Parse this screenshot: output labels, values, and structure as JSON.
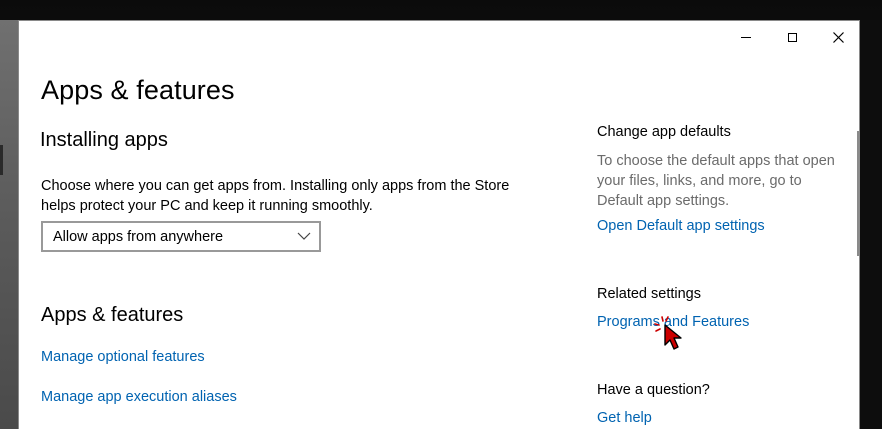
{
  "window": {
    "title": "Apps & features",
    "controls": {
      "minimize_icon": "minimize-icon",
      "maximize_icon": "maximize-icon",
      "close_icon": "close-icon"
    }
  },
  "main": {
    "installing": {
      "heading": "Installing apps",
      "description": "Choose where you can get apps from. Installing only apps from the Store helps protect your PC and keep it running smoothly.",
      "dropdown_value": "Allow apps from anywhere"
    },
    "apps": {
      "heading": "Apps & features",
      "links": [
        "Manage optional features",
        "Manage app execution aliases"
      ]
    }
  },
  "sidebar": {
    "defaults": {
      "heading": "Change app defaults",
      "description": "To choose the default apps that open your files, links, and more, go to Default app settings.",
      "link": "Open Default app settings"
    },
    "related": {
      "heading": "Related settings",
      "link": "Programs and Features"
    },
    "question": {
      "heading": "Have a question?",
      "link": "Get help"
    }
  },
  "colors": {
    "link": "#0063b1",
    "muted_text": "#6b6b6b",
    "cursor_fill": "#cc0000"
  }
}
